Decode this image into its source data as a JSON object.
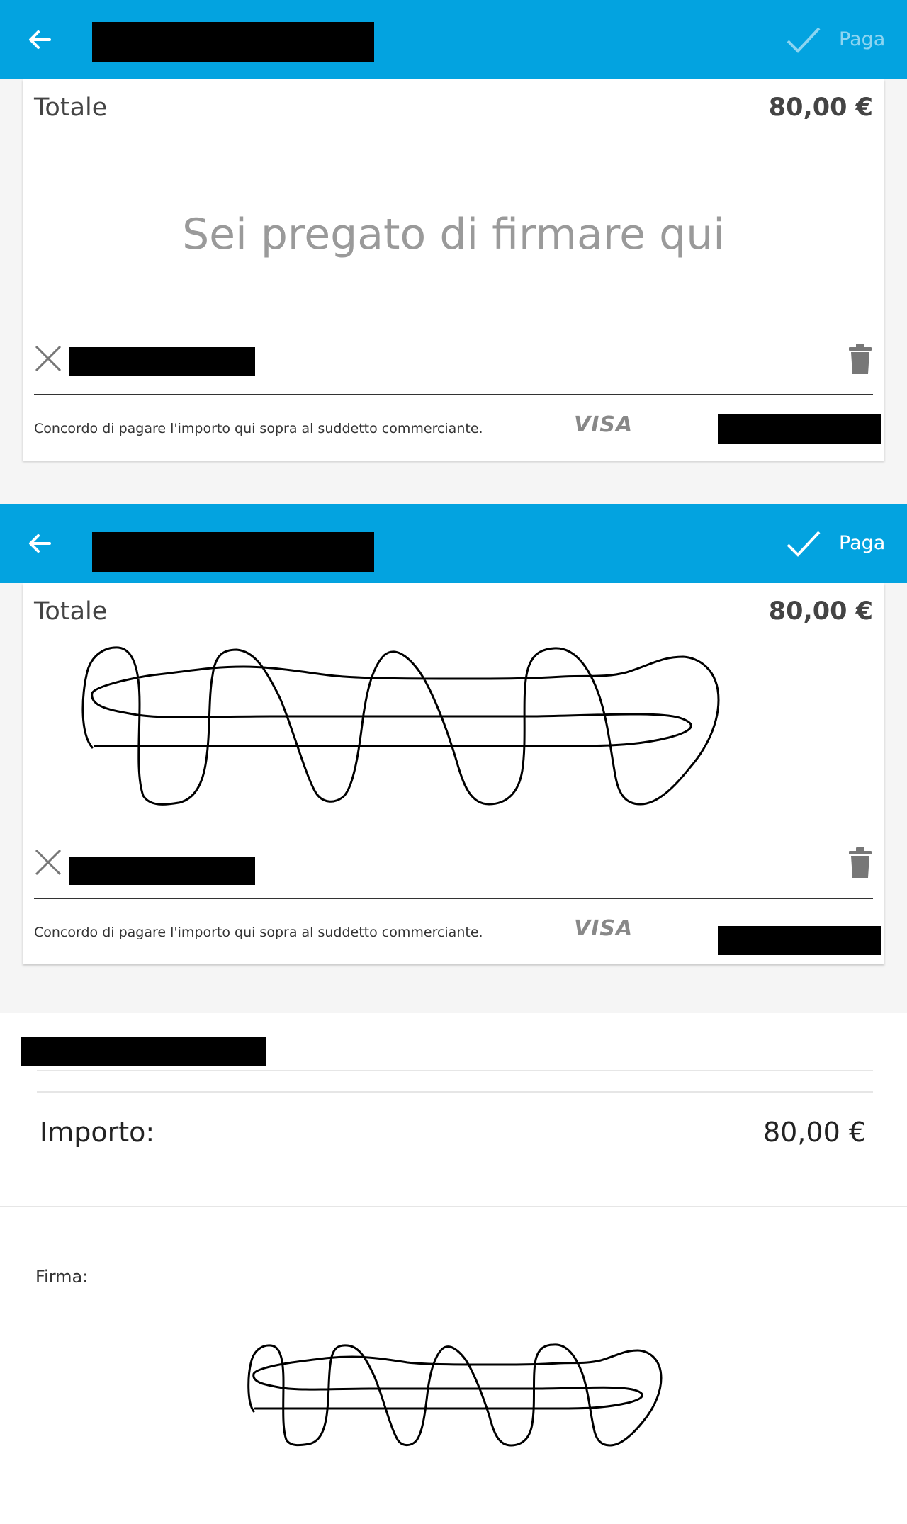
{
  "screen1": {
    "header": {
      "back_icon": "arrow-left-icon",
      "confirm_icon": "checkmark-icon",
      "pay_label": "Paga"
    },
    "card": {
      "total_label": "Totale",
      "total_value": "80,00 €",
      "signature_hint": "Sei pregato di firmare qui",
      "clear_icon": "close-icon",
      "delete_icon": "trash-icon",
      "agreement_text": "Concordo di pagare l'importo qui sopra al suddetto commerciante.",
      "card_brand": "VISA"
    }
  },
  "screen2": {
    "header": {
      "back_icon": "arrow-left-icon",
      "confirm_icon": "checkmark-icon",
      "pay_label": "Paga"
    },
    "card": {
      "total_label": "Totale",
      "total_value": "80,00 €",
      "clear_icon": "close-icon",
      "delete_icon": "trash-icon",
      "agreement_text": "Concordo di pagare l'importo qui sopra al suddetto commerciante.",
      "card_brand": "VISA"
    }
  },
  "receipt": {
    "amount_label": "Importo:",
    "amount_value": "80,00 €",
    "signature_label": "Firma:"
  },
  "colors": {
    "accent": "#03a3e0",
    "background": "#f5f5f5"
  }
}
